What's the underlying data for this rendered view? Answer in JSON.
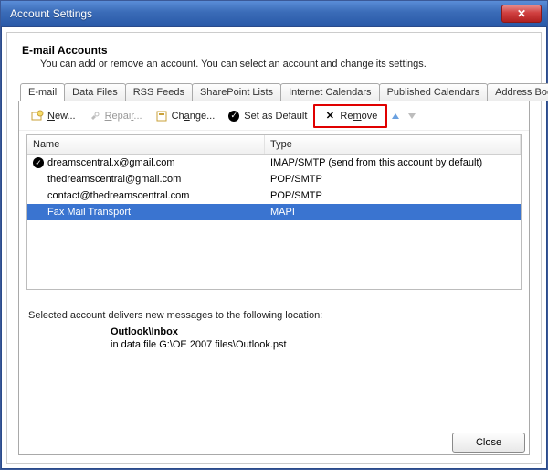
{
  "window": {
    "title": "Account Settings"
  },
  "header": {
    "title": "E-mail Accounts",
    "subtitle": "You can add or remove an account. You can select an account and change its settings."
  },
  "tabs": {
    "active": 0,
    "items": [
      {
        "label": "E-mail"
      },
      {
        "label": "Data Files"
      },
      {
        "label": "RSS Feeds"
      },
      {
        "label": "SharePoint Lists"
      },
      {
        "label": "Internet Calendars"
      },
      {
        "label": "Published Calendars"
      },
      {
        "label": "Address Books"
      }
    ]
  },
  "toolbar": {
    "new_label": "New...",
    "repair_label": "Repair...",
    "change_label": "Change...",
    "default_label": "Set as Default",
    "remove_label": "Remove"
  },
  "columns": {
    "name": "Name",
    "type": "Type"
  },
  "accounts": [
    {
      "name": "dreamscentral.x@gmail.com",
      "type": "IMAP/SMTP (send from this account by default)",
      "default": true,
      "selected": false
    },
    {
      "name": "thedreamscentral@gmail.com",
      "type": "POP/SMTP",
      "default": false,
      "selected": false
    },
    {
      "name": "contact@thedreamscentral.com",
      "type": "POP/SMTP",
      "default": false,
      "selected": false
    },
    {
      "name": "Fax Mail Transport",
      "type": "MAPI",
      "default": false,
      "selected": true
    }
  ],
  "location": {
    "intro": "Selected account delivers new messages to the following location:",
    "folder": "Outlook\\Inbox",
    "path": "in data file G:\\OE 2007 files\\Outlook.pst"
  },
  "buttons": {
    "close": "Close"
  },
  "colors": {
    "highlight": "#e00000",
    "selection": "#3a74d0"
  }
}
